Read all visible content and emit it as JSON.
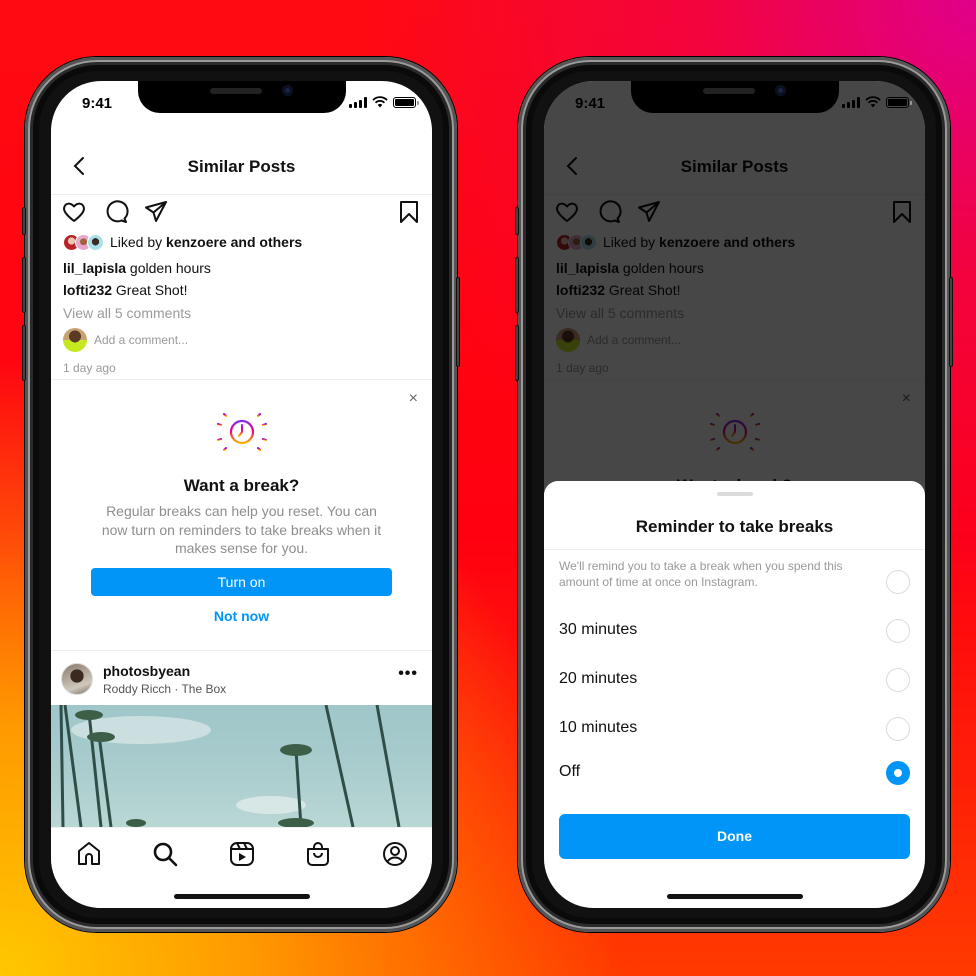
{
  "colors": {
    "accent": "#0095f6",
    "text_primary": "#111111",
    "text_muted": "#8e8e8e",
    "background_gradient": [
      "#ffc800",
      "#ff7a00",
      "#ff0010",
      "#e0008a"
    ]
  },
  "left_phone": {
    "status_bar": {
      "time": "9:41",
      "icons": [
        "signal-icon",
        "wifi-icon",
        "battery-icon"
      ]
    },
    "header": {
      "back_icon": "chevron-left-icon",
      "title": "Similar Posts"
    },
    "post_actions": [
      "heart-icon",
      "comment-icon",
      "share-icon",
      "bookmark-icon"
    ],
    "post": {
      "liked_by_prefix": "Liked by ",
      "liked_by_user": "kenzoere",
      "liked_by_suffix": " and others",
      "caption_user": "lil_lapisla",
      "caption_text": " golden hours",
      "comment_user": "lofti232",
      "comment_text": " Great Shot!",
      "view_all_comments": "View all 5 comments",
      "add_comment_placeholder": "Add a comment...",
      "time_ago": "1 day ago"
    },
    "break_card": {
      "close_icon": "×",
      "title": "Want a break?",
      "body": "Regular breaks can help you reset. You can now turn on reminders to take breaks when it makes sense for you.",
      "primary_button": "Turn on",
      "secondary_button": "Not now"
    },
    "next_post": {
      "username": "photosbyean",
      "audio": "Roddy Ricch · The Box",
      "more_icon": "•••"
    },
    "tab_bar": [
      "home-icon",
      "search-icon",
      "reels-icon",
      "shop-icon",
      "profile-icon"
    ]
  },
  "right_phone": {
    "status_bar": {
      "time": "9:41"
    },
    "header": {
      "title": "Similar Posts"
    },
    "post": {
      "liked_by_prefix": "Liked by ",
      "liked_by_user": "kenzoere",
      "liked_by_suffix": " and others",
      "caption_user": "lil_lapisla",
      "caption_text": " golden hours",
      "comment_user": "lofti232",
      "comment_text": " Great Shot!",
      "view_all_comments": "View all 5 comments",
      "add_comment_placeholder": "Add a comment...",
      "time_ago": "1 day ago"
    },
    "break_card_title": "Want a break?",
    "sheet": {
      "title": "Reminder to take breaks",
      "description": "We'll remind you to take a break when you spend this amount of time at once on Instagram.",
      "options": [
        {
          "label": "30 minutes",
          "selected": false
        },
        {
          "label": "20 minutes",
          "selected": false
        },
        {
          "label": "10 minutes",
          "selected": false
        },
        {
          "label": "Off",
          "selected": true
        }
      ],
      "done_button": "Done"
    }
  }
}
